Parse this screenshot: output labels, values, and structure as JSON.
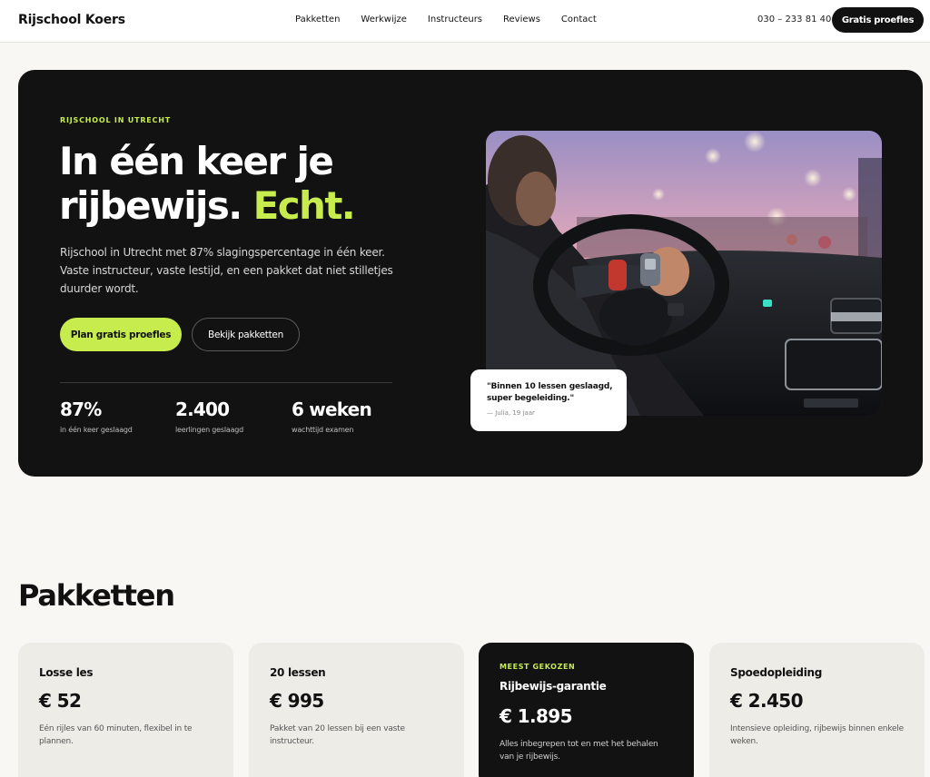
{
  "header": {
    "logo": "Rijschool Koers",
    "nav": [
      "Pakketten",
      "Werkwijze",
      "Instructeurs",
      "Reviews",
      "Contact"
    ],
    "phone": "030 – 233 81 40",
    "cta": "Gratis proefles"
  },
  "hero": {
    "eyebrow": "RIJSCHOOL IN UTRECHT",
    "headline_main": "In één keer je rijbewijs.",
    "headline_accent": "Echt.",
    "lead": "Rijschool in Utrecht met 87% slagingspercentage in één keer. Vaste instructeur, vaste lestijd, en een pakket dat niet stilletjes duurder wordt.",
    "primary_button": "Plan gratis proefles",
    "secondary_button": "Bekijk pakketten",
    "stats": [
      {
        "value": "87%",
        "label": "in één keer geslaagd"
      },
      {
        "value": "2.400",
        "label": "leerlingen geslaagd"
      },
      {
        "value": "6 weken",
        "label": "wachttijd examen"
      }
    ],
    "quote": {
      "text": "\"Binnen 10 lessen geslaagd, super begeleiding.\"",
      "author": "— Julia, 19 jaar"
    }
  },
  "packages": {
    "title": "Pakketten",
    "cards": [
      {
        "name": "Losse les",
        "price": "€ 52",
        "desc": "Eén rijles van 60 minuten, flexibel in te plannen."
      },
      {
        "name": "20 lessen",
        "price": "€ 995",
        "desc": "Pakket van 20 lessen bij een vaste instructeur."
      },
      {
        "badge": "MEEST GEKOZEN",
        "name": "Rijbewijs-garantie",
        "price": "€ 1.895",
        "desc": "Alles inbegrepen tot en met het behalen van je rijbewijs."
      },
      {
        "name": "Spoedopleiding",
        "price": "€ 2.450",
        "desc": "Intensieve opleiding, rijbewijs binnen enkele weken."
      }
    ]
  },
  "colors": {
    "accent": "#c6ec4e",
    "dark": "#121212",
    "background": "#f8f7f4",
    "card": "#eeece6"
  }
}
